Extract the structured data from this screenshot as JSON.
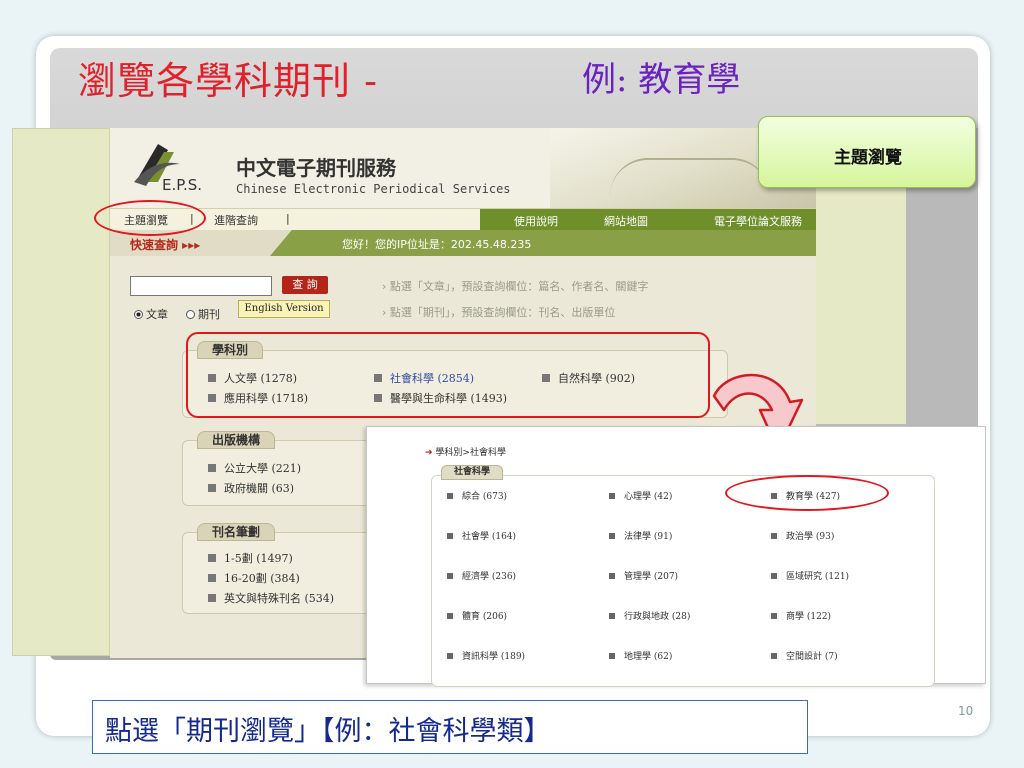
{
  "slide": {
    "title": "瀏覽各學科期刊 -",
    "subtitle": "例: 教育學",
    "callout": "主題瀏覽",
    "caption": "點選「期刊瀏覽」【例：社會科學類】",
    "page_number": "10"
  },
  "site": {
    "logo_text": "E.P.S.",
    "name_cn": "中文電子期刊服務",
    "name_en": "Chinese Electronic Periodical Services",
    "nav": [
      "主題瀏覽",
      "|",
      "進階查詢",
      "|"
    ],
    "nav_right": [
      "使用說明",
      "網站地圖",
      "電子學位論文服務"
    ],
    "quick_search": "快速查詢 ▸▸▸",
    "ip_text": "您好！您的IP位址是：202.45.48.235",
    "search_placeholder": "",
    "search_button": "查 詢",
    "radio_article": "文章",
    "radio_journal": "期刊",
    "english_button": "English Version",
    "hint1": "› 點選「文章」，預設查詢欄位：篇名、作者名、關鍵字",
    "hint2": "› 點選「期刊」，預設查詢欄位：刊名、出版單位"
  },
  "subjects": {
    "label": "學科別",
    "items": [
      "人文學 (1278)",
      "社會科學 (2854)",
      "自然科學 (902)",
      "應用科學 (1718)",
      "醫學與生命科學 (1493)"
    ]
  },
  "publishers": {
    "label": "出版機構",
    "items": [
      "公立大學 (221)",
      "政府機關 (63)"
    ]
  },
  "strokes": {
    "label": "刊名筆劃",
    "items": [
      "1-5劃 (1497)",
      "16-20劃 (384)",
      "英文與特殊刊名 (534)"
    ]
  },
  "inset": {
    "breadcrumb": "學科別>社會科學",
    "tag": "社會科學",
    "items": [
      "綜合 (673)",
      "心理學 (42)",
      "教育學 (427)",
      "社會學 (164)",
      "法律學 (91)",
      "政治學 (93)",
      "經濟學 (236)",
      "管理學 (207)",
      "區域研究 (121)",
      "體育 (206)",
      "行政與地政 (28)",
      "商學 (122)",
      "資訊科學 (189)",
      "地理學 (62)",
      "空間設計 (7)"
    ]
  },
  "colors": {
    "title": "#e0212c",
    "subtitle": "#6a22c0",
    "highlight": "#e0171f",
    "site_green": "#6f8f2a",
    "caption_text": "#152a8f"
  }
}
